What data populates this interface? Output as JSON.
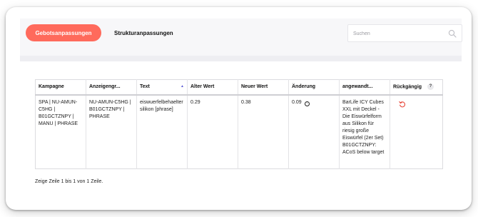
{
  "tabs": {
    "active_label": "Gebotsanpassungen",
    "inactive_label": "Strukturanpassungen"
  },
  "search": {
    "placeholder": "Suchen"
  },
  "table": {
    "headers": {
      "kampagne": "Kampagne",
      "anzeigengruppe": "Anzeigengr...",
      "text": "Text",
      "alter_wert": "Alter Wert",
      "neuer_wert": "Neuer Wert",
      "aenderung": "Änderung",
      "angewandt": "angewandt...",
      "rueckgaengig": "Rückgängig",
      "help": "?"
    },
    "rows": [
      {
        "kampagne": "SPA | NU-AMUN-C5HG | B01GCTZNPY | MANU | PHRASE",
        "anzeigengruppe": "NU-AMUN-C5HG | B01GCTZNPY | PHRASE",
        "text": "eiswuerfelbehaelter silikon [phrase]",
        "alter_wert": "0.29",
        "neuer_wert": "0.38",
        "aenderung": "0.09",
        "angewandt": "BarLife ICY Cubes XXL mit Deckel - Die Eiswürfelform aus Silikon für riesig große Eiswürfel (2er Set) B01GCTZNPY: ACoS below target"
      }
    ]
  },
  "footer": {
    "info": "Zeige Zeile 1 bis 1 von 1 Zeile."
  },
  "colors": {
    "accent": "#ff6a5c",
    "undo": "#e8473a",
    "sort": "#5b5bd6"
  }
}
